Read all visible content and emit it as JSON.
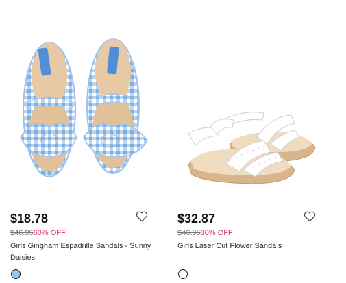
{
  "products": [
    {
      "price": "$18.78",
      "original_price": "$46.95",
      "discount": "60% OFF",
      "title": "Girls Gingham Espadrille Sandals - Sunny Daisies",
      "swatch_color": "#9cc3ea",
      "wishlist_icon": "heart-outline-icon"
    },
    {
      "price": "$32.87",
      "original_price": "$46.95",
      "discount": "30% OFF",
      "title": "Girls Laser Cut Flower Sandals",
      "swatch_color": "#ffffff",
      "wishlist_icon": "heart-outline-icon"
    }
  ],
  "colors": {
    "discount": "#d6336c",
    "gingham": "#9cc3ea",
    "sole": "#e2c9a4"
  }
}
